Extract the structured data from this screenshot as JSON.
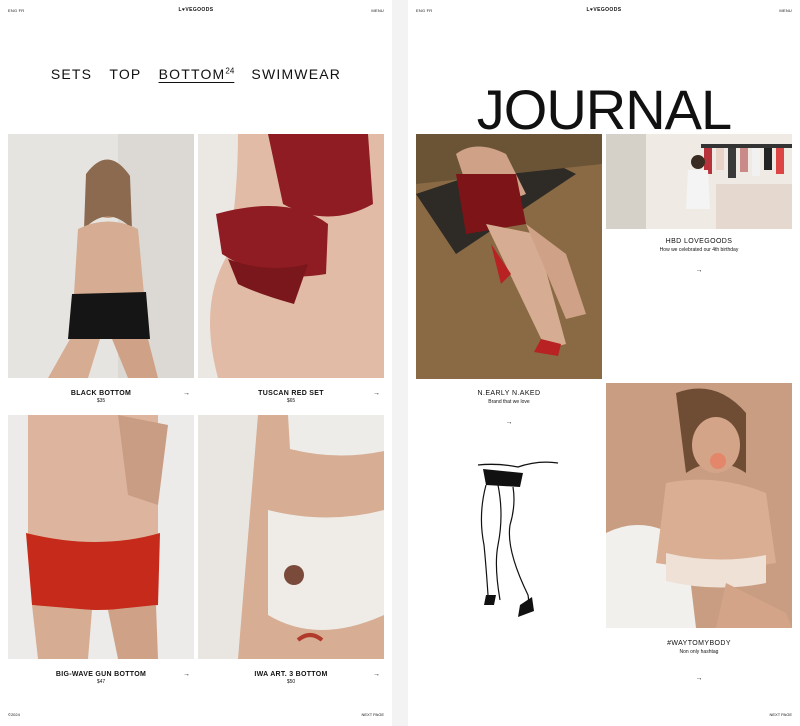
{
  "shop": {
    "topbar": {
      "lang": "ENG  FR",
      "logo": "L♥VEGOODS",
      "menu": "MENU"
    },
    "nav": [
      {
        "label": "SETS"
      },
      {
        "label": "TOP"
      },
      {
        "label": "BOTTOM",
        "count": "24"
      },
      {
        "label": "SWIMWEAR"
      }
    ],
    "products": [
      {
        "name": "BLACK BOTTOM",
        "price": "$35"
      },
      {
        "name": "TUSCAN RED SET",
        "price": "$65"
      },
      {
        "name": "BIG-WAVE GUN BOTTOM",
        "price": "$47"
      },
      {
        "name": "IWA ART. 3 BOTTOM",
        "price": "$50"
      }
    ],
    "arrow": "→",
    "footer": {
      "copy": "©2024",
      "right": "NEXT PAGE"
    }
  },
  "journal": {
    "topbar": {
      "lang": "ENG  FR",
      "logo": "L♥VEGOODS",
      "menu": "MENU"
    },
    "title": "JOURNAL",
    "cards": [
      {
        "title": "HBD LOVEGOODS",
        "subtitle": "How we celebrated our 4th birthday"
      },
      {
        "title": "N.EARLY N.AKED",
        "subtitle": "Brand that we love"
      },
      {
        "title": "#WAYTOMYBODY",
        "subtitle": "Non only hashtag"
      }
    ],
    "arrow": "→",
    "footer": {
      "right": "NEXT PAGE"
    }
  },
  "colors": {
    "tuscan_red": "#8e1c22",
    "gun_red": "#c62a1a",
    "skin": "#d9b39c",
    "wall": "#e9e7e4"
  }
}
